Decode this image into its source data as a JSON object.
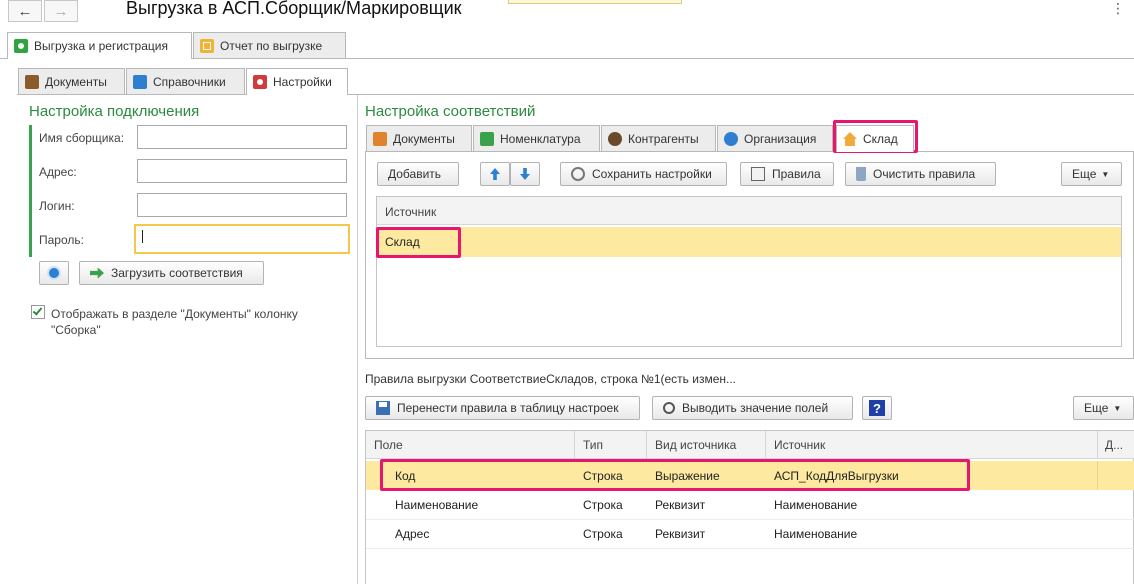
{
  "titlebar": {
    "back": "←",
    "forward": "→",
    "title": "Выгрузка в АСП.Сборщик/Маркировщик",
    "menu": "⋮"
  },
  "top_tabs": [
    "Выгрузка и регистрация",
    "Отчет по выгрузке"
  ],
  "sub_tabs": [
    "Документы",
    "Справочники",
    "Настройки"
  ],
  "connection": {
    "title": "Настройка подключения",
    "collector_label": "Имя сборщика:",
    "address_label": "Адрес:",
    "login_label": "Логин:",
    "password_label": "Пароль:",
    "load_button": "Загрузить соответствия",
    "show_column_checkbox": "Отображать в разделе \"Документы\" колонку",
    "show_column_checkbox_2": "\"Сборка\""
  },
  "mapping": {
    "title": "Настройка соответствий",
    "tabs": [
      "Документы",
      "Номенклатура",
      "Контрагенты",
      "Организация",
      "Склад"
    ],
    "toolbar": {
      "add": "Добавить",
      "save": "Сохранить настройки",
      "rules": "Правила",
      "clear": "Очистить правила",
      "more": "Еще"
    },
    "grid_header": "Источник",
    "grid_row": "Склад"
  },
  "rules": {
    "caption": "Правила выгрузки СоответствиеСкладов, строка №1(есть измен...",
    "transfer": "Перенести правила в таблицу настроек",
    "show_values": "Выводить значение полей",
    "help": "?",
    "more": "Еще",
    "columns": [
      "Поле",
      "Тип",
      "Вид источника",
      "Источник",
      "Д..."
    ],
    "rows": [
      [
        "Код",
        "Строка",
        "Выражение",
        "АСП_КодДляВыгрузки"
      ],
      [
        "Наименование",
        "Строка",
        "Реквизит",
        "Наименование"
      ],
      [
        "Адрес",
        "Строка",
        "Реквизит",
        "Наименование"
      ]
    ]
  },
  "colors": {
    "accent_green": "#2c8a3e",
    "highlight": "#fde9a0",
    "callout": "#e8166f",
    "focus": "#f2c94c"
  }
}
